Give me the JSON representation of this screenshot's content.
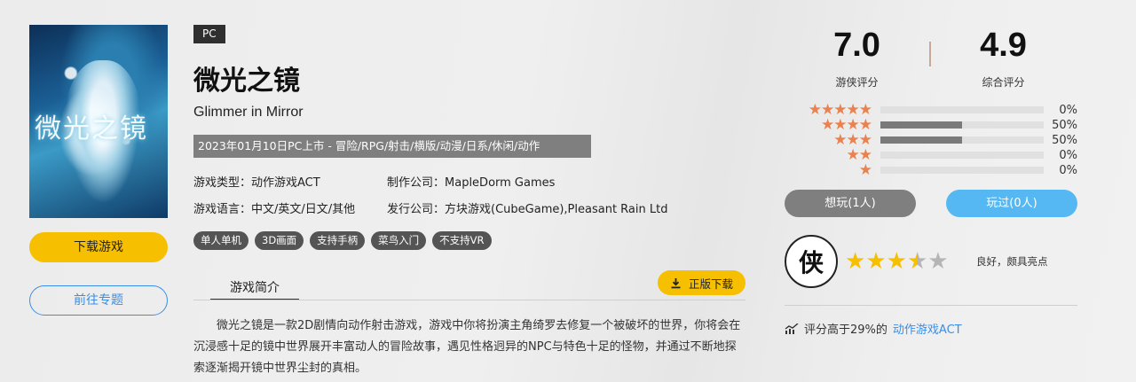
{
  "cover": {
    "title_art": "微光之镜"
  },
  "left": {
    "download_label": "下载游戏",
    "topic_label": "前往专题"
  },
  "game": {
    "platform": "PC",
    "title_cn": "微光之镜",
    "title_en": "Glimmer in Mirror",
    "release_line": "2023年01月10日PC上市 - 冒险/RPG/射击/横版/动漫/日系/休闲/动作",
    "type_label": "游戏类型：",
    "type_value": "动作游戏ACT",
    "developer_label": "制作公司：",
    "developer_value": "MapleDorm Games",
    "language_label": "游戏语言：",
    "language_value": "中文/英文/日文/其他",
    "publisher_label": "发行公司：",
    "publisher_value": "方块游戏(CubeGame),Pleasant Rain Ltd",
    "tags": [
      "单人单机",
      "3D画面",
      "支持手柄",
      "菜鸟入门",
      "不支持VR"
    ]
  },
  "intro": {
    "tab_label": "游戏简介",
    "official_download_label": "正版下载",
    "text": "微光之镜是一款2D剧情向动作射击游戏，游戏中你将扮演主角绮罗去修复一个被破坏的世界，你将会在沉浸感十足的镜中世界展开丰富动人的冒险故事，遇见性格迥异的NPC与特色十足的怪物，并通过不断地探索逐渐揭开镜中世界尘封的真相。"
  },
  "scores": {
    "youxia_score": "7.0",
    "youxia_label": "游侠评分",
    "overall_score": "4.9",
    "overall_label": "综合评分"
  },
  "rating_distribution": [
    {
      "stars": "★★★★★",
      "fraction": 0.0,
      "pct": "0%"
    },
    {
      "stars": "★★★★",
      "fraction": 0.5,
      "pct": "50%"
    },
    {
      "stars": "★★★",
      "fraction": 0.5,
      "pct": "50%"
    },
    {
      "stars": "★★",
      "fraction": 0.0,
      "pct": "0%"
    },
    {
      "stars": "★",
      "fraction": 0.0,
      "pct": "0%"
    }
  ],
  "actions": {
    "want_label": "想玩(1人)",
    "played_label": "玩过(0人)"
  },
  "review": {
    "logo_char": "侠",
    "star_rating": 3.5,
    "star_max": 5,
    "comment": "良好，颇具亮点"
  },
  "compare": {
    "prefix": "评分高于29%的",
    "link": "动作游戏ACT"
  },
  "colors": {
    "accent_yellow": "#f6bf00",
    "accent_blue": "#3a8ee6",
    "star_orange": "#e9824e"
  }
}
